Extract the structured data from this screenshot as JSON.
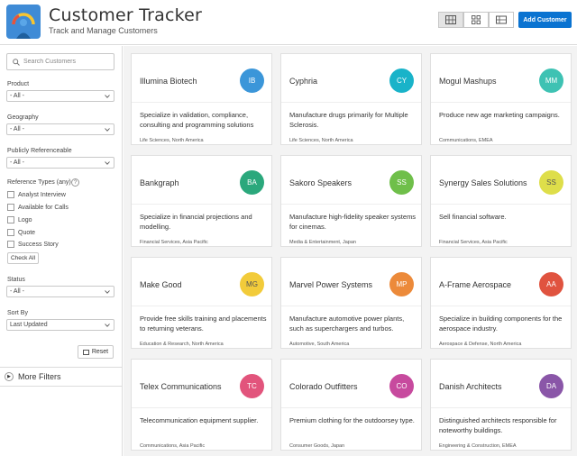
{
  "header": {
    "title": "Customer Tracker",
    "subtitle": "Track and Manage Customers",
    "add_button": "Add Customer",
    "views": [
      "grid-view-icon",
      "tile-view-icon",
      "list-view-icon"
    ],
    "accent": "#0a73d1"
  },
  "sidebar": {
    "search_placeholder": "Search Customers",
    "filters": {
      "product": {
        "label": "Product",
        "value": "- All -"
      },
      "geography": {
        "label": "Geography",
        "value": "- All -"
      },
      "publicly_referenceable": {
        "label": "Publicly Referenceable",
        "value": "- All -"
      },
      "reference_types": {
        "label": "Reference Types (any)",
        "options": [
          "Analyst Interview",
          "Available for Calls",
          "Logo",
          "Quote",
          "Success Story"
        ],
        "check_all": "Check All"
      },
      "status": {
        "label": "Status",
        "value": "- All -"
      },
      "sort_by": {
        "label": "Sort By",
        "value": "Last Updated"
      }
    },
    "reset": "Reset",
    "more_filters": "More Filters"
  },
  "customers": [
    {
      "name": "Illumina Biotech",
      "initials": "IB",
      "color": "#3b96d9",
      "desc": "Specialize in validation, compliance, consulting and programming solutions",
      "meta": "Life Sciences, North America"
    },
    {
      "name": "Cyphria",
      "initials": "CY",
      "color": "#19b3c9",
      "desc": "Manufacture drugs primarily for Multiple Sclerosis.",
      "meta": "Life Sciences, North America"
    },
    {
      "name": "Mogul Mashups",
      "initials": "MM",
      "color": "#3ec2b3",
      "desc": "Produce new age marketing campaigns.",
      "meta": "Communications, EMEA"
    },
    {
      "name": "Bankgraph",
      "initials": "BA",
      "color": "#2ba87c",
      "desc": "Specialize in financial projections and modelling.",
      "meta": "Financial Services, Asia Pacific"
    },
    {
      "name": "Sakoro Speakers",
      "initials": "SS",
      "color": "#6fbf4a",
      "desc": "Manufacture high-fidelity speaker systems for cinemas.",
      "meta": "Media & Entertainment, Japan"
    },
    {
      "name": "Synergy Sales Solutions",
      "initials": "SS",
      "color": "#dede4a",
      "desc": "Sell financial software.",
      "meta": "Financial Services, Asia Pacific"
    },
    {
      "name": "Make Good",
      "initials": "MG",
      "color": "#f2cb3a",
      "desc": "Provide free skills training and placements to returning veterans.",
      "meta": "Education & Research, North America"
    },
    {
      "name": "Marvel Power Systems",
      "initials": "MP",
      "color": "#ec8a3a",
      "desc": "Manufacture automotive power plants, such as superchargers and turbos.",
      "meta": "Automotive, South America"
    },
    {
      "name": "A-Frame Aerospace",
      "initials": "AA",
      "color": "#e0533f",
      "desc": "Specialize in building components for the aerospace industry.",
      "meta": "Aerospace & Defense, North America"
    },
    {
      "name": "Telex Communications",
      "initials": "TC",
      "color": "#e2547c",
      "desc": "Telecommunication equipment supplier.",
      "meta": "Communications, Asia Pacific"
    },
    {
      "name": "Colorado Outfitters",
      "initials": "CO",
      "color": "#c74a9e",
      "desc": "Premium clothing for the outdoorsey type.",
      "meta": "Consumer Goods, Japan"
    },
    {
      "name": "Danish Architects",
      "initials": "DA",
      "color": "#8a56a8",
      "desc": "Distinguished architects responsible for noteworthy buildings.",
      "meta": "Engineering & Construction, EMEA"
    }
  ]
}
